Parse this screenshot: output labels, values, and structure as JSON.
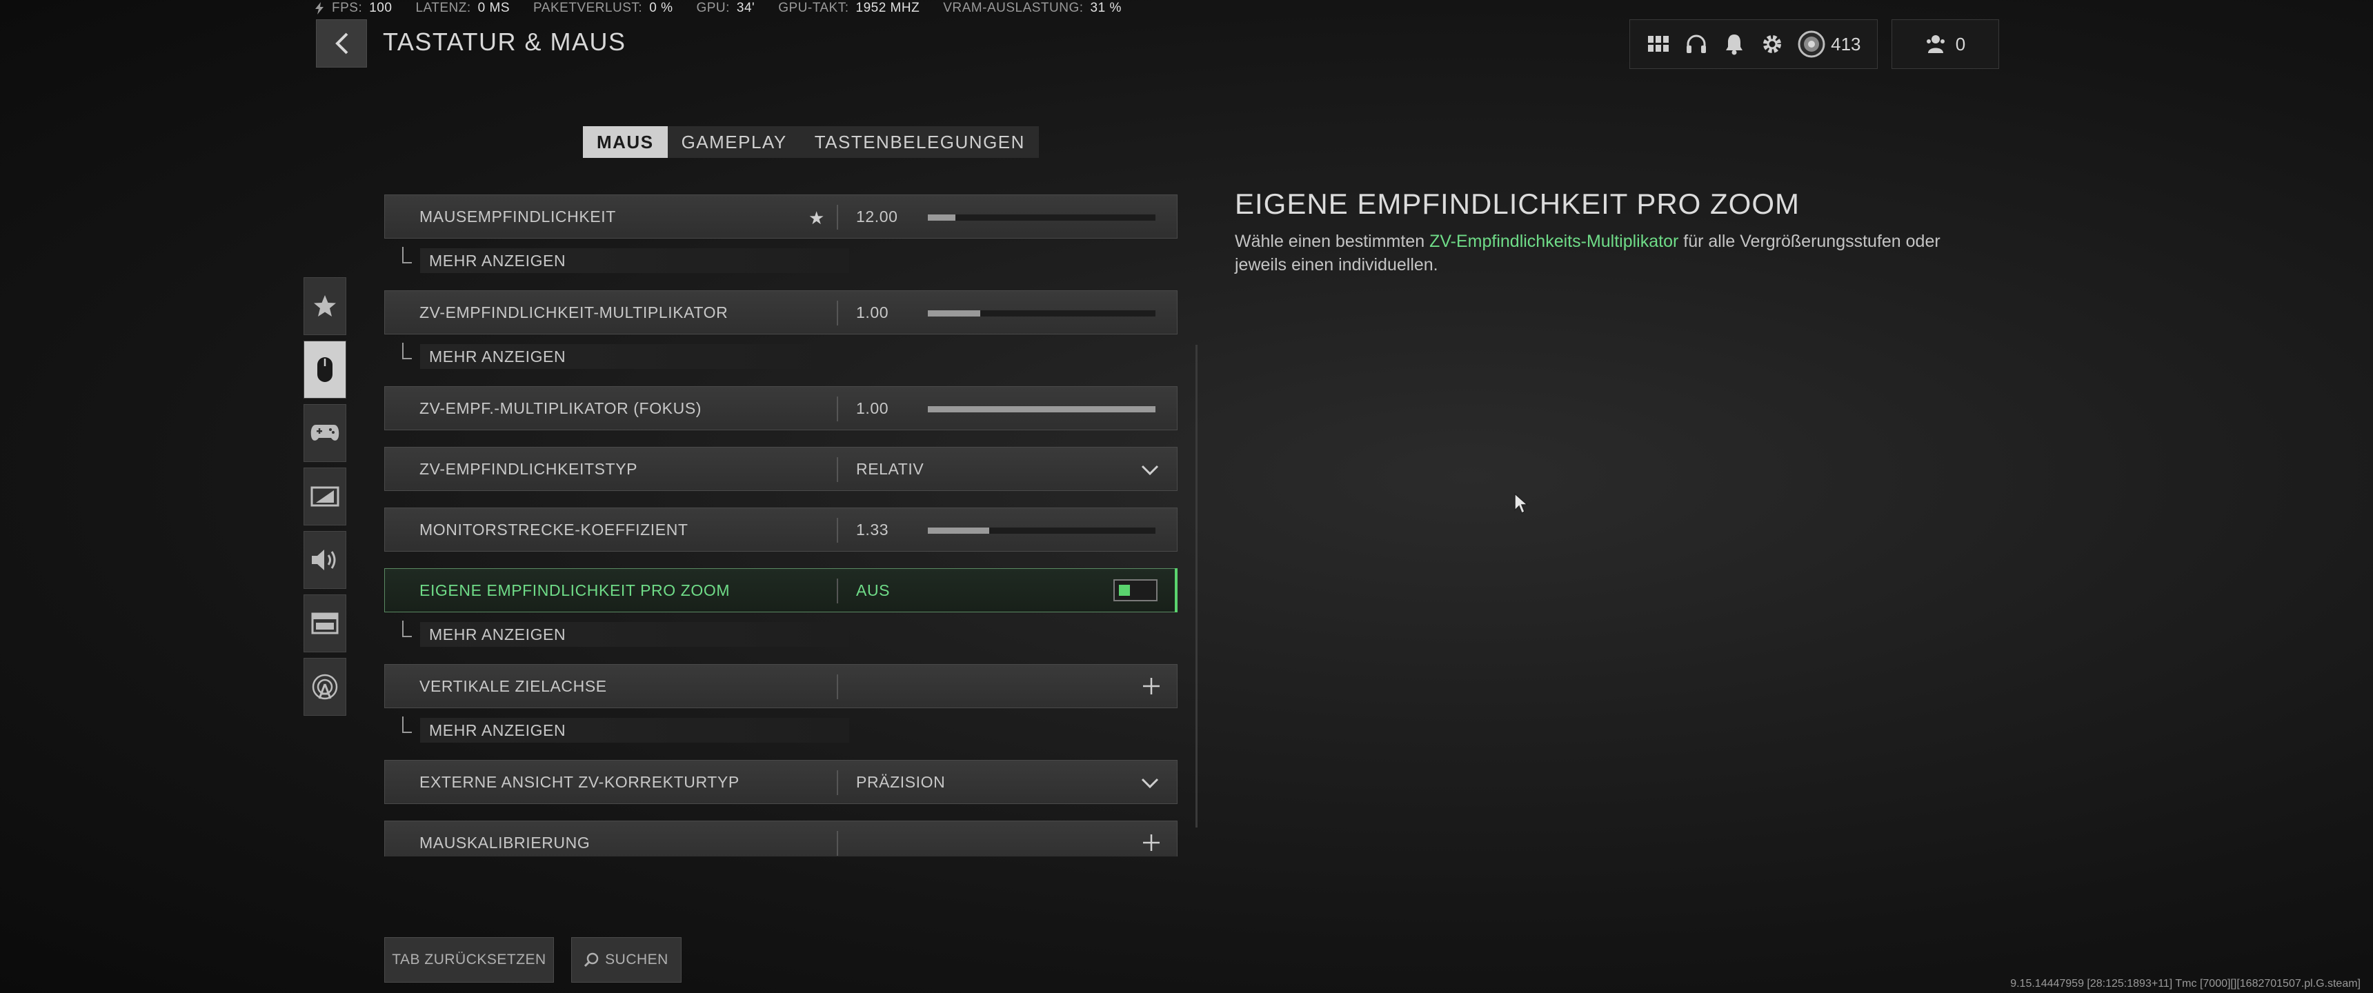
{
  "stats": {
    "fps_label": "FPS:",
    "fps_value": "100",
    "latency_label": "LATENZ:",
    "latency_value": "0 MS",
    "packetloss_label": "PAKETVERLUST:",
    "packetloss_value": "0 %",
    "gpu_label": "GPU:",
    "gpu_value": "34'",
    "gpuclock_label": "GPU-TAKT:",
    "gpuclock_value": "1952 MHZ",
    "vram_label": "VRAM-AUSLASTUNG:",
    "vram_value": "31 %"
  },
  "header": {
    "title": "TASTATUR & MAUS"
  },
  "top_right": {
    "currency": "413",
    "friends_count": "0"
  },
  "tabs": [
    {
      "label": "MAUS",
      "active": true
    },
    {
      "label": "GAMEPLAY",
      "active": false
    },
    {
      "label": "TASTENBELEGUNGEN",
      "active": false
    }
  ],
  "sidebar": {
    "icons": [
      "star-icon",
      "mouse-icon",
      "gamepad-icon",
      "display-icon",
      "speaker-icon",
      "interface-icon",
      "network-icon"
    ],
    "active_index": 1
  },
  "settings": {
    "show_more_label": "MEHR ANZEIGEN",
    "rows": [
      {
        "label": "MAUSEMPFINDLICHKEIT",
        "value": "12.00",
        "slider_fraction": 0.12
      },
      {
        "label": "ZV-EMPFINDLICHKEIT-MULTIPLIKATOR",
        "value": "1.00",
        "slider_fraction": 0.23
      },
      {
        "label": "ZV-EMPF.-MULTIPLIKATOR (FOKUS)",
        "value": "1.00",
        "slider_fraction": 1.0
      },
      {
        "label": "ZV-EMPFINDLICHKEITSTYP",
        "value": "RELATIV"
      },
      {
        "label": "MONITORSTRECKE-KOEFFIZIENT",
        "value": "1.33",
        "slider_fraction": 0.27
      },
      {
        "label": "EIGENE EMPFINDLICHKEIT PRO ZOOM",
        "value": "AUS"
      },
      {
        "label": "VERTIKALE ZIELACHSE"
      },
      {
        "label": "EXTERNE ANSICHT ZV-KORREKTURTYP",
        "value": "PRÄZISION"
      },
      {
        "label": "MAUSKALIBRIERUNG"
      }
    ]
  },
  "detail": {
    "title": "EIGENE EMPFINDLICHKEIT PRO ZOOM",
    "desc_before": "Wähle einen bestimmten ",
    "desc_highlight": "ZV-Empfindlichkeits-Multiplikator",
    "desc_after": " für alle Vergrößerungsstufen oder jeweils einen individuellen."
  },
  "footer": {
    "reset_label": "TAB ZURÜCKSETZEN",
    "search_label": "SUCHEN",
    "build_info": "9.15.14447959 [28:125:1893+11] Tmc [7000][][1682701507.pl.G.steam]"
  },
  "colors": {
    "accent_green": "#5ad46e",
    "highlight_text": "#6fdc88"
  }
}
